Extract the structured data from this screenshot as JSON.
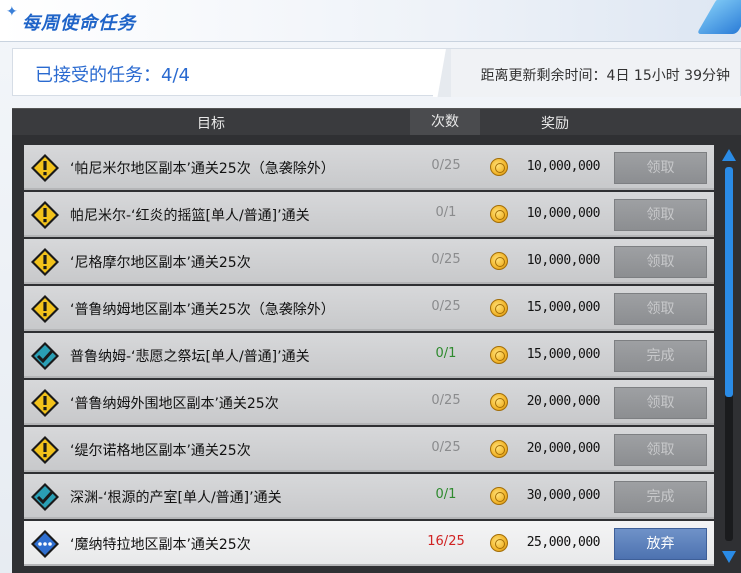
{
  "window": {
    "title": "每周使命任务"
  },
  "banner": {
    "accepted_text": "已接受的任务：4/4",
    "timer_text": "距离更新剩余时间：4日 15小时 39分钟"
  },
  "table": {
    "headers": {
      "goal": "目标",
      "count": "次数",
      "reward": "奖励"
    },
    "rows": [
      {
        "goal": "‘帕尼米尔地区副本’通关25次（急袭除外）",
        "count": "0/25",
        "count_state": "pending",
        "reward": "10,000,000",
        "button": "领取",
        "icon": "warning-icon"
      },
      {
        "goal": "帕尼米尔-‘红炎的摇篮[单人/普通]’通关",
        "count": "0/1",
        "count_state": "pending",
        "reward": "10,000,000",
        "button": "领取",
        "icon": "warning-icon"
      },
      {
        "goal": "‘尼格摩尔地区副本’通关25次",
        "count": "0/25",
        "count_state": "pending",
        "reward": "10,000,000",
        "button": "领取",
        "icon": "warning-icon"
      },
      {
        "goal": "‘普鲁纳姆地区副本’通关25次（急袭除外）",
        "count": "0/25",
        "count_state": "pending",
        "reward": "15,000,000",
        "button": "领取",
        "icon": "warning-icon"
      },
      {
        "goal": "普鲁纳姆-‘悲愿之祭坛[单人/普通]’通关",
        "count": "0/1",
        "count_state": "done",
        "reward": "15,000,000",
        "button": "完成",
        "icon": "check-icon"
      },
      {
        "goal": "‘普鲁纳姆外围地区副本’通关25次",
        "count": "0/25",
        "count_state": "pending",
        "reward": "20,000,000",
        "button": "领取",
        "icon": "warning-icon"
      },
      {
        "goal": "‘缇尔诺格地区副本’通关25次",
        "count": "0/25",
        "count_state": "pending",
        "reward": "20,000,000",
        "button": "领取",
        "icon": "warning-icon"
      },
      {
        "goal": "深渊-‘根源的产室[单人/普通]’通关",
        "count": "0/1",
        "count_state": "done",
        "reward": "30,000,000",
        "button": "完成",
        "icon": "check-icon"
      },
      {
        "goal": "‘魔纳特拉地区副本’通关25次",
        "count": "16/25",
        "count_state": "progress",
        "reward": "25,000,000",
        "button": "放弃",
        "icon": "in-progress-icon"
      }
    ]
  },
  "scrollbar": {
    "position": 0.0
  }
}
